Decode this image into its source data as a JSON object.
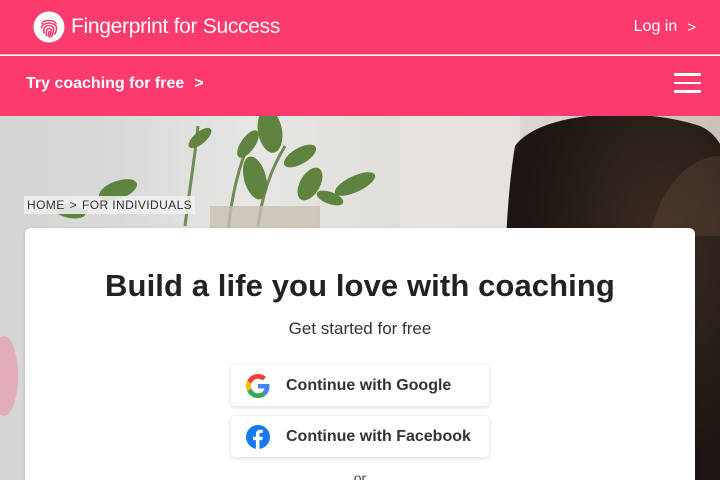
{
  "header": {
    "brand_primary": "Fingerprint",
    "brand_secondary": " for Success",
    "login_label": "Log in",
    "login_chevron": ">",
    "brand_color": "#fb3b6d"
  },
  "subnav": {
    "cta_label": "Try coaching for free",
    "cta_chevron": ">"
  },
  "breadcrumb": {
    "home": "HOME",
    "separator": ">",
    "current": "FOR INDIVIDUALS"
  },
  "signup_card": {
    "headline": "Build a life you love with coaching",
    "subhead": "Get started for free",
    "google_button": "Continue with Google",
    "facebook_button": "Continue with Facebook",
    "divider": "or"
  },
  "icons": {
    "logo": "fingerprint-logo-icon",
    "menu": "hamburger-menu-icon",
    "google": "google-g-icon",
    "facebook": "facebook-f-icon"
  }
}
